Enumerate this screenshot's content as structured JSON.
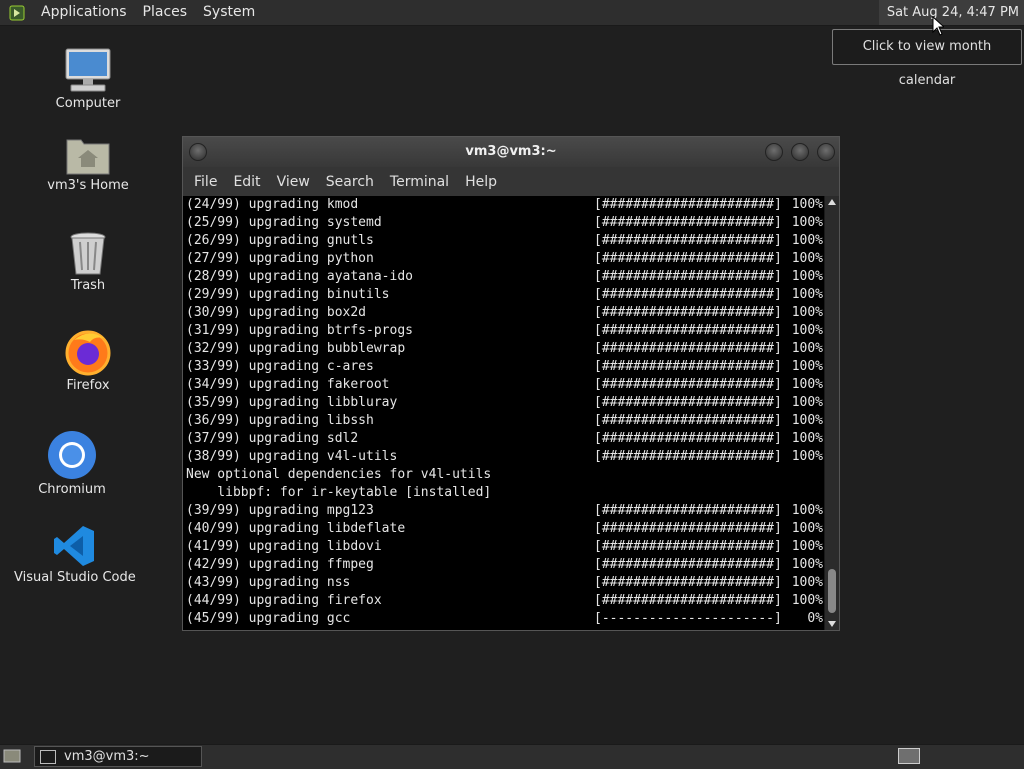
{
  "top_panel": {
    "menus": [
      "Applications",
      "Places",
      "System"
    ],
    "clock": "Sat Aug 24,  4:47 PM",
    "tooltip": "Click to view month calendar"
  },
  "desktop_icons": {
    "computer": "Computer",
    "home": "vm3's Home",
    "trash": "Trash",
    "firefox": "Firefox",
    "chromium": "Chromium",
    "vscode": "Visual Studio Code"
  },
  "terminal": {
    "title": "vm3@vm3:~",
    "menu": [
      "File",
      "Edit",
      "View",
      "Search",
      "Terminal",
      "Help"
    ],
    "lines": [
      {
        "text": "(24/99) upgrading kmod",
        "bar": "[######################]",
        "pct": "100%"
      },
      {
        "text": "(25/99) upgrading systemd",
        "bar": "[######################]",
        "pct": "100%"
      },
      {
        "text": "(26/99) upgrading gnutls",
        "bar": "[######################]",
        "pct": "100%"
      },
      {
        "text": "(27/99) upgrading python",
        "bar": "[######################]",
        "pct": "100%"
      },
      {
        "text": "(28/99) upgrading ayatana-ido",
        "bar": "[######################]",
        "pct": "100%"
      },
      {
        "text": "(29/99) upgrading binutils",
        "bar": "[######################]",
        "pct": "100%"
      },
      {
        "text": "(30/99) upgrading box2d",
        "bar": "[######################]",
        "pct": "100%"
      },
      {
        "text": "(31/99) upgrading btrfs-progs",
        "bar": "[######################]",
        "pct": "100%"
      },
      {
        "text": "(32/99) upgrading bubblewrap",
        "bar": "[######################]",
        "pct": "100%"
      },
      {
        "text": "(33/99) upgrading c-ares",
        "bar": "[######################]",
        "pct": "100%"
      },
      {
        "text": "(34/99) upgrading fakeroot",
        "bar": "[######################]",
        "pct": "100%"
      },
      {
        "text": "(35/99) upgrading libbluray",
        "bar": "[######################]",
        "pct": "100%"
      },
      {
        "text": "(36/99) upgrading libssh",
        "bar": "[######################]",
        "pct": "100%"
      },
      {
        "text": "(37/99) upgrading sdl2",
        "bar": "[######################]",
        "pct": "100%"
      },
      {
        "text": "(38/99) upgrading v4l-utils",
        "bar": "[######################]",
        "pct": "100%"
      },
      {
        "text": "New optional dependencies for v4l-utils",
        "bar": "",
        "pct": ""
      },
      {
        "text": "    libbpf: for ir-keytable [installed]",
        "bar": "",
        "pct": ""
      },
      {
        "text": "(39/99) upgrading mpg123",
        "bar": "[######################]",
        "pct": "100%"
      },
      {
        "text": "(40/99) upgrading libdeflate",
        "bar": "[######################]",
        "pct": "100%"
      },
      {
        "text": "(41/99) upgrading libdovi",
        "bar": "[######################]",
        "pct": "100%"
      },
      {
        "text": "(42/99) upgrading ffmpeg",
        "bar": "[######################]",
        "pct": "100%"
      },
      {
        "text": "(43/99) upgrading nss",
        "bar": "[######################]",
        "pct": "100%"
      },
      {
        "text": "(44/99) upgrading firefox",
        "bar": "[######################]",
        "pct": "100%"
      },
      {
        "text": "(45/99) upgrading gcc",
        "bar": "[----------------------]",
        "pct": "0%"
      }
    ]
  },
  "taskbar": {
    "window_title": "vm3@vm3:~"
  },
  "colors": {
    "desktop_bg": "#1f1f1f",
    "panel_bg": "#2e2e2e",
    "terminal_bg": "#000000",
    "terminal_fg": "#e6e6e6"
  }
}
